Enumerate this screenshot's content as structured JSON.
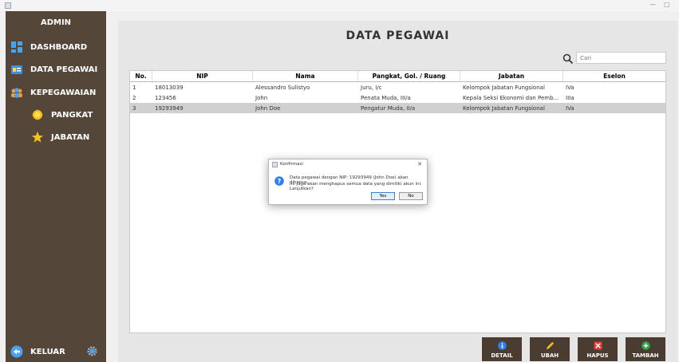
{
  "window": {
    "minimize": "—",
    "maximize": "□"
  },
  "sidebar": {
    "title": "ADMIN",
    "items": [
      {
        "label": "DASHBOARD",
        "icon": "dashboard-icon"
      },
      {
        "label": "DATA PEGAWAI",
        "icon": "id-card-icon"
      },
      {
        "label": "KEPEGAWAIAN",
        "icon": "people-icon"
      },
      {
        "label": "PANGKAT",
        "icon": "medal-icon"
      },
      {
        "label": "JABATAN",
        "icon": "star-icon"
      }
    ],
    "logout_label": "KELUAR"
  },
  "main": {
    "title": "DATA PEGAWAI",
    "search_placeholder": "Cari",
    "columns": [
      "No.",
      "NIP",
      "Nama",
      "Pangkat, Gol. / Ruang",
      "Jabatan",
      "Eselon"
    ],
    "rows": [
      [
        "1",
        "18013039",
        "Alessandro Sulistyo",
        "Juru, I/c",
        "Kelompok Jabatan Fungsional",
        "IVa"
      ],
      [
        "2",
        "123456",
        "John",
        "Penata Muda, III/a",
        "Kepala Seksi Ekonomi dan Pemb...",
        "IIIa"
      ],
      [
        "3",
        "19293949",
        "John Doe",
        "Pengatur Muda, II/a",
        "Kelompok Jabatan Fungsional",
        "IVa"
      ]
    ],
    "buttons": {
      "detail": "DETAIL",
      "ubah": "UBAH",
      "hapus": "HAPUS",
      "tambah": "TAMBAH"
    }
  },
  "dialog": {
    "title": "Konfirmasi",
    "message_line1": "Data pegawai dengan NIP: 19293949 (John Doe) akan dihapus.",
    "message_line2": "Ini juga akan menghapus semua data yang dimiliki akun ini. Lanjutkan?",
    "yes_label": "Yes",
    "no_label": "No"
  },
  "colors": {
    "sidebar": "#55463a",
    "button": "#4a3c30",
    "accent_blue": "#2f80ed"
  }
}
